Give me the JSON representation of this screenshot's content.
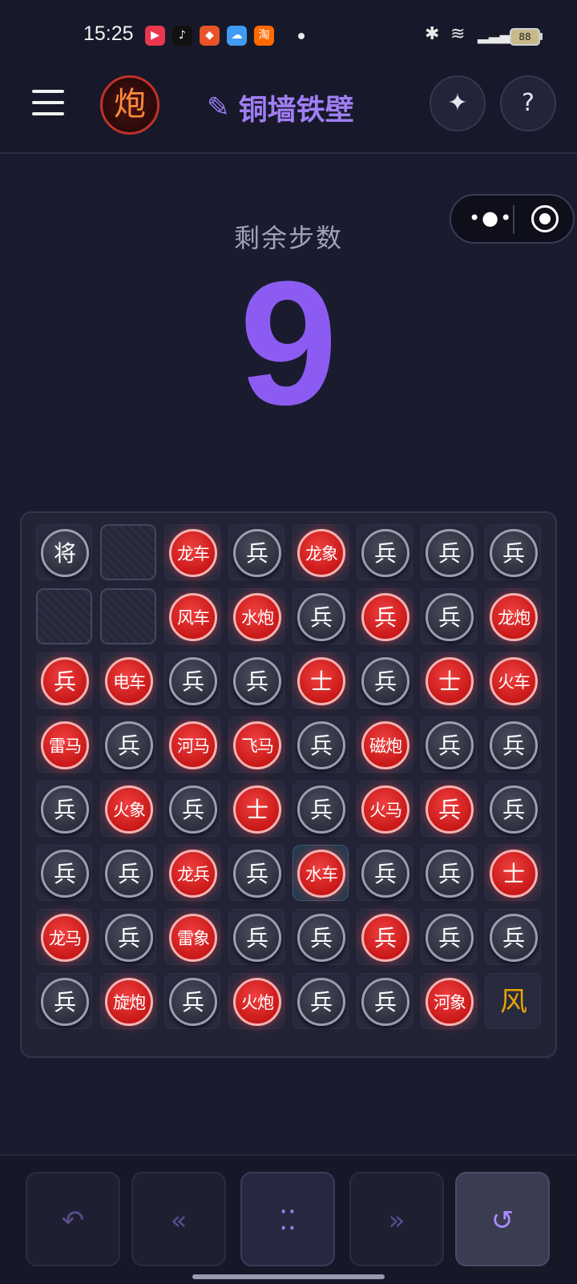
{
  "status_bar": {
    "time": "15:25",
    "app_icons": [
      {
        "name": "video-app-icon",
        "glyph": "▶",
        "color": "#e9374e"
      },
      {
        "name": "tiktok-icon",
        "glyph": "♪",
        "color": "#111111"
      },
      {
        "name": "shopping-app-icon",
        "glyph": "◆",
        "color": "#e8532a"
      },
      {
        "name": "weather-app-icon",
        "glyph": "☁",
        "color": "#3f9cf2"
      },
      {
        "name": "taobao-icon",
        "glyph": "淘",
        "color": "#ff6a00"
      }
    ],
    "battery": "88"
  },
  "header": {
    "logo_glyph": "炮",
    "title_icon": "✎",
    "title": "铜墙铁壁",
    "sparkle_glyph": "✦",
    "help_glyph": "?"
  },
  "steps": {
    "label": "剩余步数",
    "value": "9"
  },
  "board": {
    "rows": [
      [
        [
          "black",
          "将"
        ],
        [
          "empty",
          ""
        ],
        [
          "red",
          "龙车"
        ],
        [
          "black",
          "兵"
        ],
        [
          "red",
          "龙象"
        ],
        [
          "black",
          "兵"
        ],
        [
          "black",
          "兵"
        ],
        [
          "black",
          "兵"
        ]
      ],
      [
        [
          "empty",
          ""
        ],
        [
          "empty",
          ""
        ],
        [
          "red",
          "风车"
        ],
        [
          "red",
          "水炮"
        ],
        [
          "black",
          "兵"
        ],
        [
          "red",
          "兵"
        ],
        [
          "black",
          "兵"
        ],
        [
          "red",
          "龙炮"
        ]
      ],
      [
        [
          "red",
          "兵"
        ],
        [
          "red",
          "电车"
        ],
        [
          "black",
          "兵"
        ],
        [
          "black",
          "兵"
        ],
        [
          "red",
          "士"
        ],
        [
          "black",
          "兵"
        ],
        [
          "red",
          "士"
        ],
        [
          "red",
          "火车"
        ]
      ],
      [
        [
          "red",
          "雷马"
        ],
        [
          "black",
          "兵"
        ],
        [
          "red",
          "河马"
        ],
        [
          "red",
          "飞马"
        ],
        [
          "black",
          "兵"
        ],
        [
          "red",
          "磁炮"
        ],
        [
          "black",
          "兵"
        ],
        [
          "black",
          "兵"
        ]
      ],
      [
        [
          "black",
          "兵"
        ],
        [
          "red",
          "火象"
        ],
        [
          "black",
          "兵"
        ],
        [
          "red",
          "士"
        ],
        [
          "black",
          "兵"
        ],
        [
          "red",
          "火马"
        ],
        [
          "red",
          "兵"
        ],
        [
          "black",
          "兵"
        ]
      ],
      [
        [
          "black",
          "兵"
        ],
        [
          "black",
          "兵"
        ],
        [
          "red",
          "龙兵"
        ],
        [
          "black",
          "兵"
        ],
        [
          "red-highlight",
          "水车"
        ],
        [
          "black",
          "兵"
        ],
        [
          "black",
          "兵"
        ],
        [
          "red",
          "士"
        ]
      ],
      [
        [
          "red",
          "龙马"
        ],
        [
          "black",
          "兵"
        ],
        [
          "red",
          "雷象"
        ],
        [
          "black",
          "兵"
        ],
        [
          "black",
          "兵"
        ],
        [
          "red",
          "兵"
        ],
        [
          "black",
          "兵"
        ],
        [
          "black",
          "兵"
        ]
      ],
      [
        [
          "black",
          "兵"
        ],
        [
          "red",
          "旋炮"
        ],
        [
          "black",
          "兵"
        ],
        [
          "red",
          "火炮"
        ],
        [
          "black",
          "兵"
        ],
        [
          "black",
          "兵"
        ],
        [
          "red",
          "河象"
        ],
        [
          "wind",
          "风"
        ]
      ]
    ]
  },
  "controls": {
    "undo": "↶",
    "prev": "«",
    "menu": "⁚⁚",
    "next": "»",
    "reset": "↺"
  }
}
